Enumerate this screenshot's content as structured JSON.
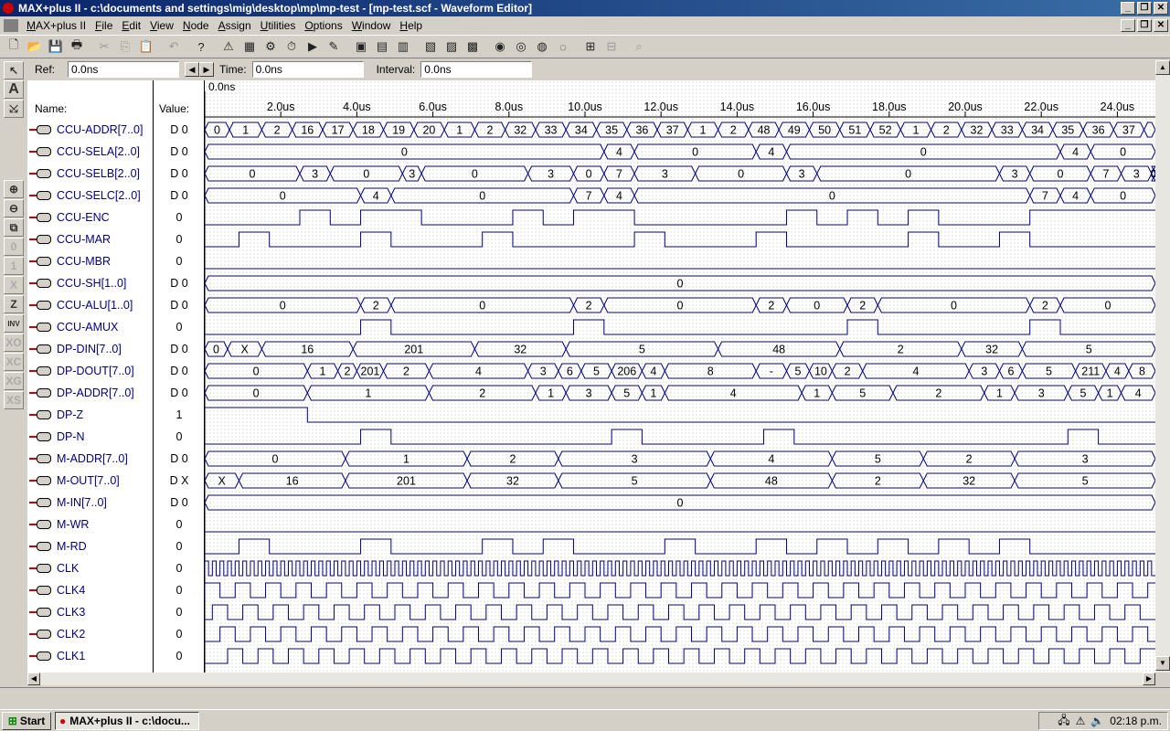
{
  "window": {
    "title": "MAX+plus II - c:\\documents and settings\\mig\\desktop\\mp\\mp-test - [mp-test.scf - Waveform Editor]"
  },
  "menu": [
    "MAX+plus II",
    "File",
    "Edit",
    "View",
    "Node",
    "Assign",
    "Utilities",
    "Options",
    "Window",
    "Help"
  ],
  "header": {
    "ref_label": "Ref:",
    "ref_value": "0.0ns",
    "time_label": "Time:",
    "time_value": "0.0ns",
    "interval_label": "Interval:",
    "interval_value": "0.0ns",
    "cursor_time": "0.0ns",
    "name_col": "Name:",
    "value_col": "Value:"
  },
  "ruler": [
    "2.0us",
    "4.0us",
    "6.0us",
    "8.0us",
    "10.0us",
    "12.0us",
    "14.0us",
    "16.0us",
    "18.0us",
    "20.0us",
    "22.0us",
    "24.0us"
  ],
  "signals": [
    {
      "name": "CCU-ADDR[7..0]",
      "value": "D 0",
      "kind": "bus",
      "seg": [
        [
          0,
          6.5,
          "0"
        ],
        [
          6.5,
          15,
          "1"
        ],
        [
          15,
          23,
          "2"
        ],
        [
          23,
          31,
          "16"
        ],
        [
          31,
          39,
          "17"
        ],
        [
          39,
          47,
          "18"
        ],
        [
          47,
          55,
          "19"
        ],
        [
          55,
          63,
          "20"
        ],
        [
          63,
          71,
          "1"
        ],
        [
          71,
          79,
          "2"
        ],
        [
          79,
          87,
          "32"
        ],
        [
          87,
          95,
          "33"
        ],
        [
          95,
          103,
          "34"
        ],
        [
          103,
          111,
          "35"
        ],
        [
          111,
          119,
          "36"
        ],
        [
          119,
          127,
          "37"
        ],
        [
          127,
          135,
          "1"
        ],
        [
          135,
          143,
          "2"
        ],
        [
          143,
          151,
          "48"
        ],
        [
          151,
          159,
          "49"
        ],
        [
          159,
          167,
          "50"
        ],
        [
          167,
          175,
          "51"
        ],
        [
          175,
          183,
          "52"
        ],
        [
          183,
          191,
          "1"
        ],
        [
          191,
          199,
          "2"
        ],
        [
          199,
          207,
          "32"
        ],
        [
          207,
          215,
          "33"
        ],
        [
          215,
          223,
          "34"
        ],
        [
          223,
          231,
          "35"
        ],
        [
          231,
          239,
          "36"
        ],
        [
          239,
          247,
          "37"
        ],
        [
          247,
          250,
          ""
        ]
      ]
    },
    {
      "name": "CCU-SELA[2..0]",
      "value": "D 0",
      "kind": "bus",
      "seg": [
        [
          0,
          105,
          "0"
        ],
        [
          105,
          113,
          "4"
        ],
        [
          113,
          145,
          "0"
        ],
        [
          145,
          153,
          "4"
        ],
        [
          153,
          225,
          "0"
        ],
        [
          225,
          233,
          "4"
        ],
        [
          233,
          250,
          "0"
        ]
      ]
    },
    {
      "name": "CCU-SELB[2..0]",
      "value": "D 0",
      "kind": "bus",
      "seg": [
        [
          0,
          25,
          "0"
        ],
        [
          25,
          33,
          "3"
        ],
        [
          33,
          52,
          "0"
        ],
        [
          52,
          57,
          "3"
        ],
        [
          57,
          85,
          "0"
        ],
        [
          85,
          97,
          "3"
        ],
        [
          97,
          105,
          "0"
        ],
        [
          105,
          113,
          "7"
        ],
        [
          113,
          129,
          "3"
        ],
        [
          129,
          153,
          "0"
        ],
        [
          153,
          161,
          "3"
        ],
        [
          161,
          209,
          "0"
        ],
        [
          209,
          217,
          "3"
        ],
        [
          217,
          233,
          "0"
        ],
        [
          233,
          241,
          "7"
        ],
        [
          241,
          249,
          "3"
        ],
        [
          249,
          250,
          "0"
        ]
      ]
    },
    {
      "name": "CCU-SELC[2..0]",
      "value": "D 0",
      "kind": "bus",
      "seg": [
        [
          0,
          41,
          "0"
        ],
        [
          41,
          49,
          "4"
        ],
        [
          49,
          97,
          "0"
        ],
        [
          97,
          105,
          "7"
        ],
        [
          105,
          113,
          "4"
        ],
        [
          113,
          217,
          "0"
        ],
        [
          217,
          225,
          "7"
        ],
        [
          225,
          233,
          "4"
        ],
        [
          233,
          250,
          "0"
        ]
      ]
    },
    {
      "name": "CCU-ENC",
      "value": "0",
      "kind": "bit",
      "seg": [
        [
          0,
          25,
          0
        ],
        [
          25,
          33,
          1
        ],
        [
          33,
          41,
          0
        ],
        [
          41,
          57,
          1
        ],
        [
          57,
          81,
          0
        ],
        [
          81,
          89,
          1
        ],
        [
          89,
          97,
          0
        ],
        [
          97,
          113,
          1
        ],
        [
          113,
          153,
          0
        ],
        [
          153,
          161,
          1
        ],
        [
          161,
          169,
          0
        ],
        [
          169,
          177,
          1
        ],
        [
          177,
          185,
          0
        ],
        [
          185,
          193,
          1
        ],
        [
          193,
          217,
          0
        ],
        [
          217,
          250,
          1
        ]
      ]
    },
    {
      "name": "CCU-MAR",
      "value": "0",
      "kind": "bit",
      "seg": [
        [
          0,
          9,
          0
        ],
        [
          9,
          17,
          1
        ],
        [
          17,
          41,
          0
        ],
        [
          41,
          49,
          1
        ],
        [
          49,
          73,
          0
        ],
        [
          73,
          81,
          1
        ],
        [
          81,
          113,
          0
        ],
        [
          113,
          121,
          1
        ],
        [
          121,
          145,
          0
        ],
        [
          145,
          153,
          1
        ],
        [
          153,
          185,
          0
        ],
        [
          185,
          193,
          1
        ],
        [
          193,
          209,
          0
        ],
        [
          209,
          217,
          1
        ],
        [
          217,
          250,
          0
        ]
      ]
    },
    {
      "name": "CCU-MBR",
      "value": "0",
      "kind": "bit",
      "seg": [
        [
          0,
          250,
          0
        ]
      ]
    },
    {
      "name": "CCU-SH[1..0]",
      "value": "D 0",
      "kind": "bus",
      "seg": [
        [
          0,
          250,
          "0"
        ]
      ]
    },
    {
      "name": "CCU-ALU[1..0]",
      "value": "D 0",
      "kind": "bus",
      "seg": [
        [
          0,
          41,
          "0"
        ],
        [
          41,
          49,
          "2"
        ],
        [
          49,
          97,
          "0"
        ],
        [
          97,
          105,
          "2"
        ],
        [
          105,
          145,
          "0"
        ],
        [
          145,
          153,
          "2"
        ],
        [
          153,
          169,
          "0"
        ],
        [
          169,
          177,
          "2"
        ],
        [
          177,
          217,
          "0"
        ],
        [
          217,
          225,
          "2"
        ],
        [
          225,
          250,
          "0"
        ]
      ]
    },
    {
      "name": "CCU-AMUX",
      "value": "0",
      "kind": "bit",
      "seg": [
        [
          0,
          41,
          0
        ],
        [
          41,
          49,
          1
        ],
        [
          49,
          97,
          0
        ],
        [
          97,
          105,
          1
        ],
        [
          105,
          169,
          0
        ],
        [
          169,
          177,
          1
        ],
        [
          177,
          217,
          0
        ],
        [
          217,
          225,
          1
        ],
        [
          225,
          250,
          0
        ]
      ]
    },
    {
      "name": "DP-DIN[7..0]",
      "value": "D 0",
      "kind": "bus",
      "seg": [
        [
          0,
          6,
          "0"
        ],
        [
          6,
          15,
          "X"
        ],
        [
          15,
          39,
          "16"
        ],
        [
          39,
          71,
          "201"
        ],
        [
          71,
          95,
          "32"
        ],
        [
          95,
          135,
          "5"
        ],
        [
          135,
          167,
          "48"
        ],
        [
          167,
          199,
          "2"
        ],
        [
          199,
          215,
          "32"
        ],
        [
          215,
          250,
          "5"
        ]
      ]
    },
    {
      "name": "DP-DOUT[7..0]",
      "value": "D 0",
      "kind": "bus",
      "seg": [
        [
          0,
          27,
          "0"
        ],
        [
          27,
          35,
          "1"
        ],
        [
          35,
          40,
          "2"
        ],
        [
          40,
          47,
          "201"
        ],
        [
          47,
          59,
          "2"
        ],
        [
          59,
          85,
          "4"
        ],
        [
          85,
          93,
          "3"
        ],
        [
          93,
          99,
          "6"
        ],
        [
          99,
          107,
          "5"
        ],
        [
          107,
          115,
          "206"
        ],
        [
          115,
          121,
          "4"
        ],
        [
          121,
          145,
          "8"
        ],
        [
          145,
          153,
          "-"
        ],
        [
          153,
          159,
          "5"
        ],
        [
          159,
          165,
          "10"
        ],
        [
          165,
          173,
          "2"
        ],
        [
          173,
          201,
          "4"
        ],
        [
          201,
          209,
          "3"
        ],
        [
          209,
          215,
          "6"
        ],
        [
          215,
          229,
          "5"
        ],
        [
          229,
          237,
          "211"
        ],
        [
          237,
          243,
          "4"
        ],
        [
          243,
          250,
          "8"
        ]
      ]
    },
    {
      "name": "DP-ADDR[7..0]",
      "value": "D 0",
      "kind": "bus",
      "seg": [
        [
          0,
          27,
          "0"
        ],
        [
          27,
          59,
          "1"
        ],
        [
          59,
          87,
          "2"
        ],
        [
          87,
          95,
          "1"
        ],
        [
          95,
          107,
          "3"
        ],
        [
          107,
          115,
          "5"
        ],
        [
          115,
          121,
          "1"
        ],
        [
          121,
          157,
          "4"
        ],
        [
          157,
          165,
          "1"
        ],
        [
          165,
          181,
          "5"
        ],
        [
          181,
          205,
          "2"
        ],
        [
          205,
          213,
          "1"
        ],
        [
          213,
          227,
          "3"
        ],
        [
          227,
          235,
          "5"
        ],
        [
          235,
          241,
          "1"
        ],
        [
          241,
          250,
          "4"
        ]
      ]
    },
    {
      "name": "DP-Z",
      "value": "1",
      "kind": "bit",
      "seg": [
        [
          0,
          27,
          1
        ],
        [
          27,
          250,
          0
        ]
      ]
    },
    {
      "name": "DP-N",
      "value": "0",
      "kind": "bit",
      "seg": [
        [
          0,
          41,
          0
        ],
        [
          41,
          49,
          1
        ],
        [
          49,
          107,
          0
        ],
        [
          107,
          115,
          1
        ],
        [
          115,
          147,
          0
        ],
        [
          147,
          155,
          1
        ],
        [
          155,
          227,
          0
        ],
        [
          227,
          235,
          1
        ],
        [
          235,
          250,
          0
        ]
      ]
    },
    {
      "name": "M-ADDR[7..0]",
      "value": "D 0",
      "kind": "bus",
      "seg": [
        [
          0,
          37,
          "0"
        ],
        [
          37,
          69,
          "1"
        ],
        [
          69,
          93,
          "2"
        ],
        [
          93,
          133,
          "3"
        ],
        [
          133,
          165,
          "4"
        ],
        [
          165,
          189,
          "5"
        ],
        [
          189,
          213,
          "2"
        ],
        [
          213,
          250,
          "3"
        ]
      ]
    },
    {
      "name": "M-OUT[7..0]",
      "value": "D X",
      "kind": "bus",
      "seg": [
        [
          0,
          9,
          "X"
        ],
        [
          9,
          37,
          "16"
        ],
        [
          37,
          69,
          "201"
        ],
        [
          69,
          93,
          "32"
        ],
        [
          93,
          133,
          "5"
        ],
        [
          133,
          165,
          "48"
        ],
        [
          165,
          189,
          "2"
        ],
        [
          189,
          213,
          "32"
        ],
        [
          213,
          250,
          "5"
        ]
      ]
    },
    {
      "name": "M-IN[7..0]",
      "value": "D 0",
      "kind": "bus",
      "seg": [
        [
          0,
          250,
          "0"
        ]
      ]
    },
    {
      "name": "M-WR",
      "value": "0",
      "kind": "bit",
      "seg": [
        [
          0,
          250,
          0
        ]
      ]
    },
    {
      "name": "M-RD",
      "value": "0",
      "kind": "bit",
      "seg": [
        [
          0,
          9,
          0
        ],
        [
          9,
          17,
          1
        ],
        [
          17,
          41,
          0
        ],
        [
          41,
          49,
          1
        ],
        [
          49,
          73,
          0
        ],
        [
          73,
          81,
          1
        ],
        [
          81,
          89,
          0
        ],
        [
          89,
          97,
          1
        ],
        [
          97,
          121,
          0
        ],
        [
          121,
          129,
          1
        ],
        [
          129,
          145,
          0
        ],
        [
          145,
          153,
          1
        ],
        [
          153,
          161,
          0
        ],
        [
          161,
          169,
          1
        ],
        [
          169,
          177,
          0
        ],
        [
          177,
          185,
          1
        ],
        [
          185,
          193,
          0
        ],
        [
          193,
          201,
          1
        ],
        [
          201,
          209,
          0
        ],
        [
          209,
          217,
          1
        ],
        [
          217,
          250,
          0
        ]
      ]
    },
    {
      "name": "CLK",
      "value": "0",
      "kind": "clock",
      "period": 2
    },
    {
      "name": "CLK4",
      "value": "0",
      "kind": "clock",
      "period": 8,
      "phase": 0
    },
    {
      "name": "CLK3",
      "value": "0",
      "kind": "clock",
      "period": 8,
      "phase": 2
    },
    {
      "name": "CLK2",
      "value": "0",
      "kind": "clock",
      "period": 8,
      "phase": 4
    },
    {
      "name": "CLK1",
      "value": "0",
      "kind": "clock",
      "period": 8,
      "phase": 6
    }
  ],
  "taskbar": {
    "start": "Start",
    "task": "MAX+plus II - c:\\docu...",
    "clock": "02:18 p.m."
  }
}
